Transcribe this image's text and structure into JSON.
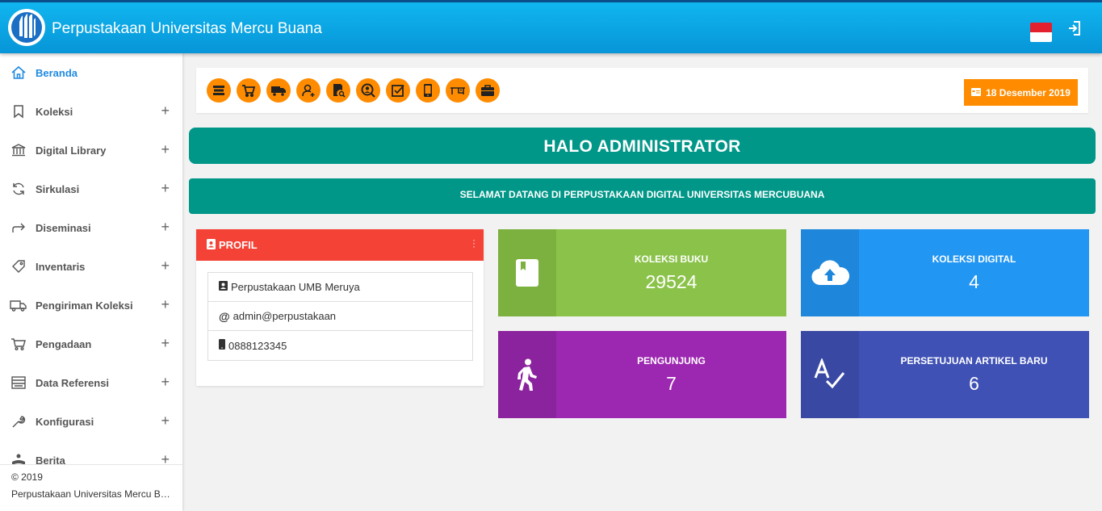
{
  "header": {
    "title": "Perpustakaan Universitas Mercu Buana",
    "flag_icon": "indonesia-flag-icon",
    "logout_icon": "logout-icon"
  },
  "sidebar": {
    "items": [
      {
        "label": "Beranda",
        "icon": "home-icon",
        "expandable": false,
        "active": true
      },
      {
        "label": "Koleksi",
        "icon": "bookmark-icon",
        "expandable": true
      },
      {
        "label": "Digital Library",
        "icon": "bank-icon",
        "expandable": true
      },
      {
        "label": "Sirkulasi",
        "icon": "refresh-icon",
        "expandable": true
      },
      {
        "label": "Diseminasi",
        "icon": "share-arrow-icon",
        "expandable": true
      },
      {
        "label": "Inventaris",
        "icon": "tag-icon",
        "expandable": true
      },
      {
        "label": "Pengiriman Koleksi",
        "icon": "truck-icon",
        "expandable": true
      },
      {
        "label": "Pengadaan",
        "icon": "cart-icon",
        "expandable": true
      },
      {
        "label": "Data Referensi",
        "icon": "list-icon",
        "expandable": true
      },
      {
        "label": "Konfigurasi",
        "icon": "wrench-icon",
        "expandable": true
      },
      {
        "label": "Berita",
        "icon": "reader-icon",
        "expandable": true
      }
    ],
    "plus": "+",
    "footer": {
      "copyright": "© 2019",
      "name": "Perpustakaan Universitas Mercu Bu..."
    }
  },
  "toolbar": {
    "tools": [
      "books-icon",
      "cart-icon",
      "truck-icon",
      "user-add-icon",
      "document-search-icon",
      "user-search-icon",
      "checkbox-icon",
      "phone-icon",
      "desk-icon",
      "briefcase-icon"
    ],
    "date": "18 Desember 2019",
    "accent": "#ff8c00"
  },
  "banners": {
    "greeting": "HALO ADMINISTRATOR",
    "welcome": "SELAMAT DATANG DI PERPUSTAKAAN DIGITAL UNIVERSITAS MERCUBUANA",
    "color": "#009688"
  },
  "profile": {
    "title": "PROFIL",
    "location": "Perpustakaan UMB Meruya",
    "email": "admin@perpustakaan",
    "phone": "0888123345",
    "color": "#f44336"
  },
  "stats": [
    {
      "title": "KOLEKSI BUKU",
      "value": "29524",
      "icon": "book-icon",
      "color": "#8bc34a",
      "side_color": "#7cb03f"
    },
    {
      "title": "KOLEKSI DIGITAL",
      "value": "4",
      "icon": "cloud-upload-icon",
      "color": "#2196f3",
      "side_color": "#1e87db"
    },
    {
      "title": "PENGUNJUNG",
      "value": "7",
      "icon": "walking-icon",
      "color": "#9c27b0",
      "side_color": "#8b239e"
    },
    {
      "title": "PERSETUJUAN ARTIKEL BARU",
      "value": "6",
      "icon": "spellcheck-icon",
      "color": "#3f51b5",
      "side_color": "#3949a3"
    }
  ]
}
